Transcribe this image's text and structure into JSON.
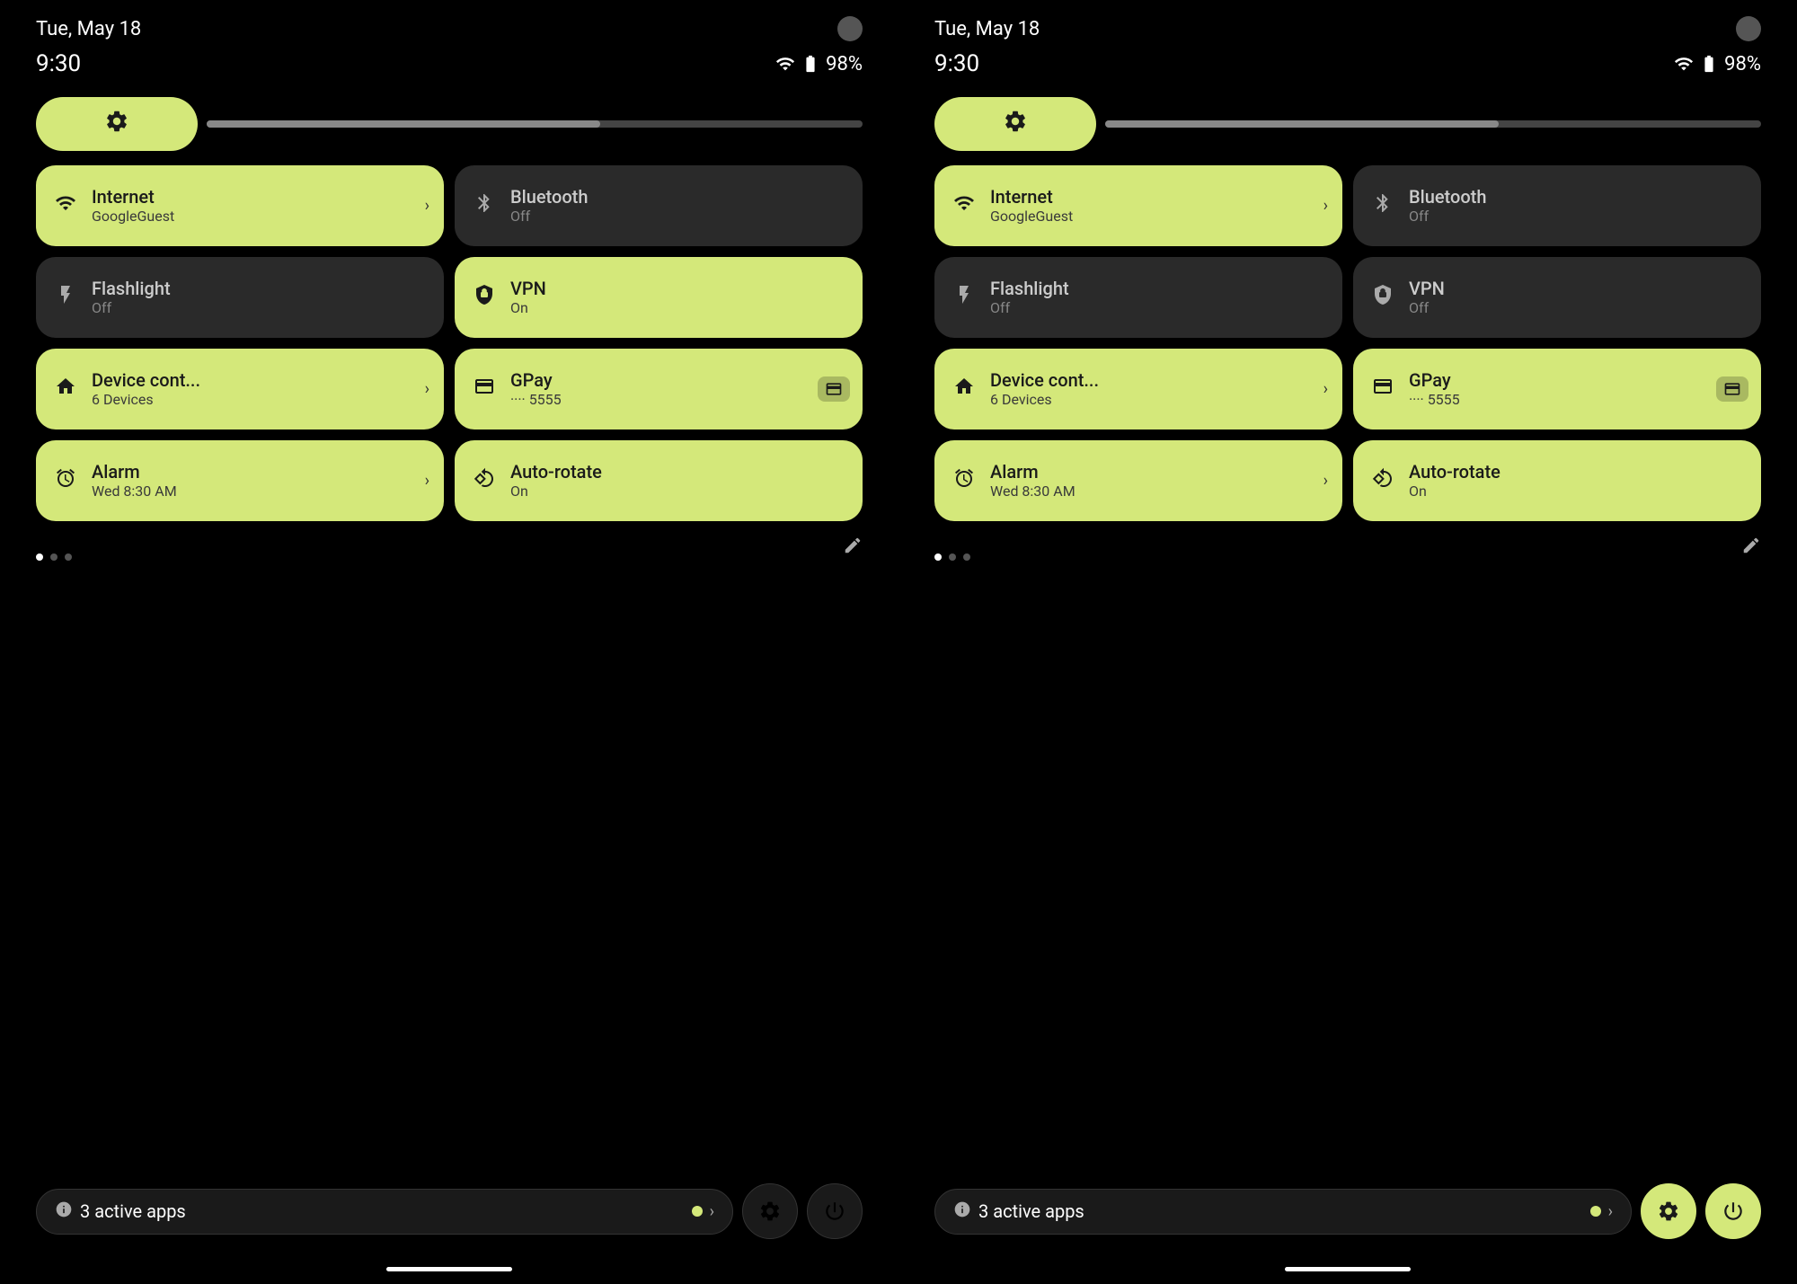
{
  "panels": [
    {
      "id": "panel-left",
      "status": {
        "date": "Tue, May 18",
        "time": "9:30",
        "battery": "98%",
        "has_wifi": true,
        "has_battery": true
      },
      "brightness": {
        "label": "brightness"
      },
      "tiles": [
        {
          "id": "internet",
          "title": "Internet",
          "subtitle": "GoogleGuest",
          "active": true,
          "icon": "wifi",
          "has_chevron": true
        },
        {
          "id": "bluetooth",
          "title": "Bluetooth",
          "subtitle": "Off",
          "active": false,
          "icon": "bluetooth",
          "has_chevron": false
        },
        {
          "id": "flashlight",
          "title": "Flashlight",
          "subtitle": "Off",
          "active": false,
          "icon": "flashlight",
          "has_chevron": false
        },
        {
          "id": "vpn",
          "title": "VPN",
          "subtitle": "On",
          "active": true,
          "icon": "vpn",
          "has_chevron": false
        },
        {
          "id": "device-control",
          "title": "Device cont...",
          "subtitle": "6 Devices",
          "active": true,
          "icon": "home",
          "has_chevron": true
        },
        {
          "id": "gpay",
          "title": "GPay",
          "subtitle": "···· 5555",
          "active": true,
          "icon": "gpay",
          "has_chevron": false,
          "has_card": true
        },
        {
          "id": "alarm",
          "title": "Alarm",
          "subtitle": "Wed 8:30 AM",
          "active": true,
          "icon": "alarm",
          "has_chevron": true
        },
        {
          "id": "autorotate",
          "title": "Auto-rotate",
          "subtitle": "On",
          "active": true,
          "icon": "rotate",
          "has_chevron": false
        }
      ],
      "bottom": {
        "active_apps_count": "3",
        "active_apps_label": "active apps",
        "gear_active": false,
        "power_active": false
      }
    },
    {
      "id": "panel-right",
      "status": {
        "date": "Tue, May 18",
        "time": "9:30",
        "battery": "98%",
        "has_wifi": true,
        "has_battery": true
      },
      "brightness": {
        "label": "brightness"
      },
      "tiles": [
        {
          "id": "internet",
          "title": "Internet",
          "subtitle": "GoogleGuest",
          "active": true,
          "icon": "wifi",
          "has_chevron": true
        },
        {
          "id": "bluetooth",
          "title": "Bluetooth",
          "subtitle": "Off",
          "active": false,
          "icon": "bluetooth",
          "has_chevron": false
        },
        {
          "id": "flashlight",
          "title": "Flashlight",
          "subtitle": "Off",
          "active": false,
          "icon": "flashlight",
          "has_chevron": false
        },
        {
          "id": "vpn",
          "title": "VPN",
          "subtitle": "Off",
          "active": false,
          "icon": "vpn",
          "has_chevron": false
        },
        {
          "id": "device-control",
          "title": "Device cont...",
          "subtitle": "6 Devices",
          "active": true,
          "icon": "home",
          "has_chevron": true
        },
        {
          "id": "gpay",
          "title": "GPay",
          "subtitle": "···· 5555",
          "active": true,
          "icon": "gpay",
          "has_chevron": false,
          "has_card": true
        },
        {
          "id": "alarm",
          "title": "Alarm",
          "subtitle": "Wed 8:30 AM",
          "active": true,
          "icon": "alarm",
          "has_chevron": true
        },
        {
          "id": "autorotate",
          "title": "Auto-rotate",
          "subtitle": "On",
          "active": true,
          "icon": "rotate",
          "has_chevron": false
        }
      ],
      "bottom": {
        "active_apps_count": "3",
        "active_apps_label": "active apps",
        "gear_active": true,
        "power_active": true
      }
    }
  ],
  "icons": {
    "wifi": "▼",
    "bluetooth": "✱",
    "flashlight": "🔦",
    "vpn": "🛡",
    "home": "⌂",
    "gpay": "💳",
    "alarm": "⏰",
    "rotate": "↻",
    "gear": "⚙",
    "power": "⏻",
    "info": "ℹ",
    "pencil": "✏",
    "chevron": "›"
  },
  "colors": {
    "active_tile": "#d4e87a",
    "inactive_tile": "#2a2a2a",
    "background": "#000000",
    "accent": "#d4e87a"
  }
}
